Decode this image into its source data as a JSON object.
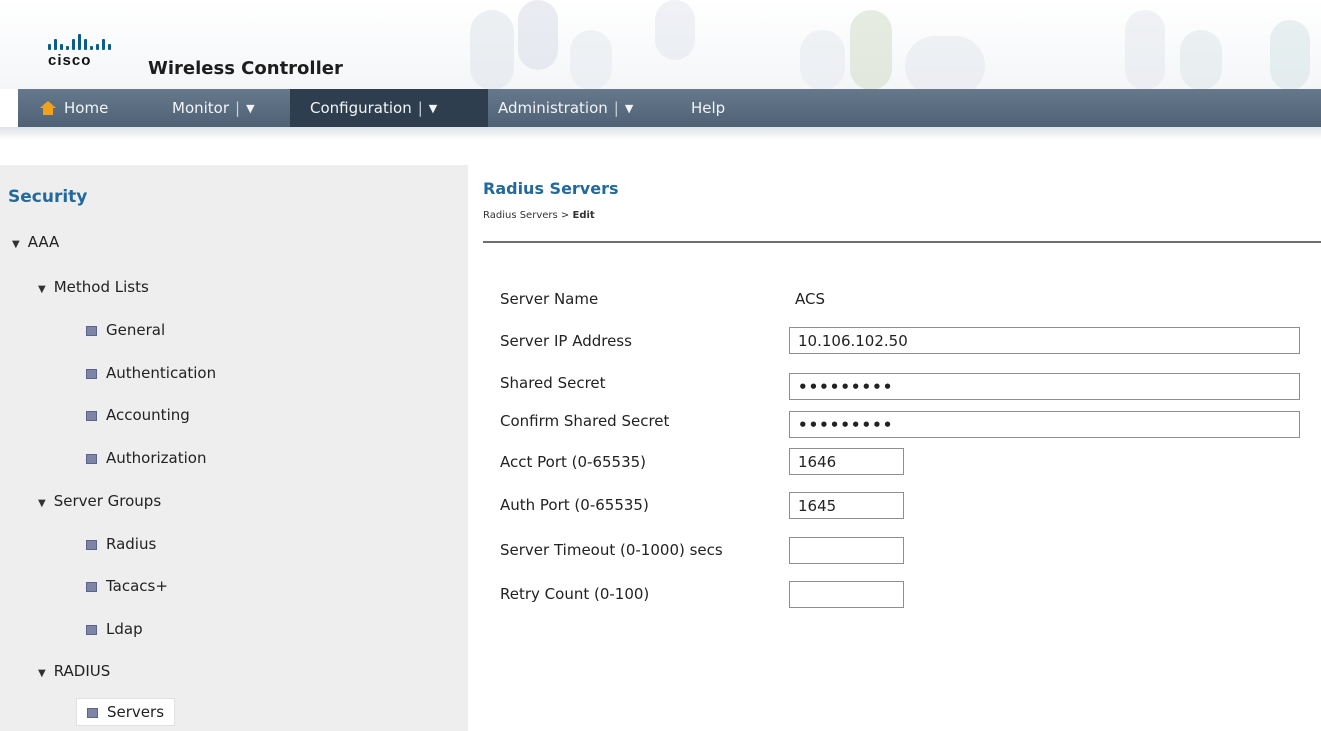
{
  "header": {
    "brand": "cisco",
    "product": "Wireless Controller"
  },
  "nav": [
    {
      "label": "Home",
      "icon": "home-icon",
      "has_menu": false
    },
    {
      "label": "Monitor",
      "has_menu": true
    },
    {
      "label": "Configuration",
      "has_menu": true,
      "active": true
    },
    {
      "label": "Administration",
      "has_menu": true
    },
    {
      "label": "Help",
      "has_menu": false
    }
  ],
  "nav_separator": "|",
  "nav_caret": "▼",
  "sidebar": {
    "title": "Security",
    "tree": [
      {
        "label": "AAA",
        "type": "group"
      },
      {
        "label": "Method Lists",
        "type": "group"
      },
      {
        "label": "General",
        "type": "leaf"
      },
      {
        "label": "Authentication",
        "type": "leaf"
      },
      {
        "label": "Accounting",
        "type": "leaf"
      },
      {
        "label": "Authorization",
        "type": "leaf"
      },
      {
        "label": "Server Groups",
        "type": "group"
      },
      {
        "label": "Radius",
        "type": "leaf"
      },
      {
        "label": "Tacacs+",
        "type": "leaf"
      },
      {
        "label": "Ldap",
        "type": "leaf"
      },
      {
        "label": "RADIUS",
        "type": "group"
      },
      {
        "label": "Servers",
        "type": "leaf",
        "selected": true
      }
    ]
  },
  "main": {
    "title": "Radius Servers",
    "breadcrumb": {
      "parent": "Radius Servers",
      "separator": ">",
      "current": "Edit"
    },
    "form": {
      "server_name": {
        "label": "Server Name",
        "value": "ACS"
      },
      "server_ip": {
        "label": "Server IP Address",
        "value": "10.106.102.50"
      },
      "shared_secret": {
        "label": "Shared Secret",
        "value": "•••••••••"
      },
      "confirm_secret": {
        "label": "Confirm Shared Secret",
        "value": "•••••••••"
      },
      "acct_port": {
        "label": "Acct Port (0-65535)",
        "value": "1646"
      },
      "auth_port": {
        "label": "Auth Port (0-65535)",
        "value": "1645"
      },
      "server_timeout": {
        "label": "Server Timeout (0-1000) secs",
        "value": ""
      },
      "retry_count": {
        "label": "Retry Count (0-100)",
        "value": ""
      }
    }
  },
  "colors": {
    "accent": "#236a9c",
    "nav_bg": "#5a6d81",
    "nav_active": "#2f3e4f",
    "sidebar_bg": "#eeeeee",
    "home_icon": "#f2a21a"
  }
}
